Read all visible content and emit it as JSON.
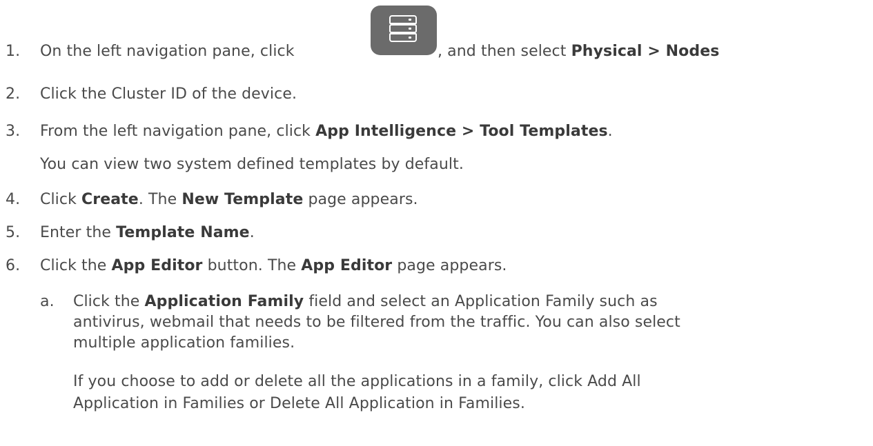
{
  "steps": [
    {
      "num": "1.",
      "pre": "On the left navigation pane, click",
      "icon": "server-stack-icon",
      "mid": ", and then select ",
      "bold": "Physical > Nodes"
    },
    {
      "num": "2.",
      "text": "Click the Cluster ID of the device."
    },
    {
      "num": "3.",
      "pre": "From the left navigation pane, click ",
      "bold": "App Intelligence > Tool Templates",
      "post": ".",
      "note": "You can view two system defined templates by default."
    },
    {
      "num": "4.",
      "pre": "Click ",
      "bold1": "Create",
      "mid": ". The ",
      "bold2": "New Template",
      "post": " page appears."
    },
    {
      "num": "5.",
      "pre": "Enter the ",
      "bold": "Template Name",
      "post": "."
    },
    {
      "num": "6.",
      "pre": "Click the ",
      "bold1": "App Editor",
      "mid": " button. The ",
      "bold2": "App Editor",
      "post": " page appears."
    }
  ],
  "substeps": [
    {
      "label": "a.",
      "pre": "Click the ",
      "bold": "Application Family",
      "line1_post": " field and select an Application Family such as",
      "line2": "antivirus, webmail that needs to be filtered from the traffic. You can also select",
      "line3": "multiple application families.",
      "note_line1": "If you choose to add or delete all the applications in a family, click Add All",
      "note_line2": "Application in Families or Delete All Application in Families."
    }
  ],
  "colors": {
    "text": "#4a4a4a",
    "bold_text": "#3a3a3a",
    "icon_bg": "#6b6b6b",
    "icon_fg": "#ffffff"
  }
}
